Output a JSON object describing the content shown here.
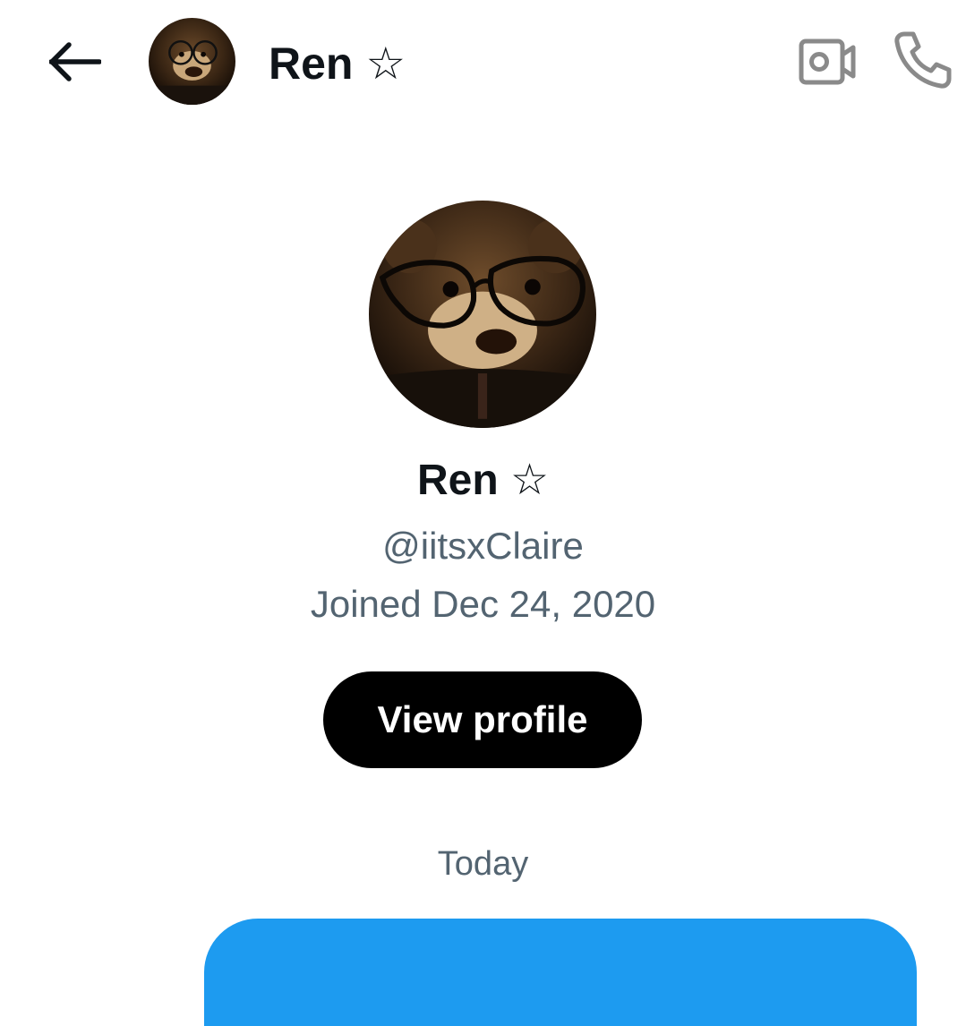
{
  "header": {
    "back_icon": "arrow-left-icon",
    "contact_name": "Ren ☆",
    "video_icon": "video-call-icon",
    "phone_icon": "phone-icon"
  },
  "profile": {
    "avatar_description_icon": "avatar",
    "name": "Ren ☆",
    "handle": "@iitsxClaire",
    "joined": "Joined Dec 24, 2020",
    "view_profile_label": "View profile"
  },
  "conversation": {
    "date_divider": "Today"
  },
  "colors": {
    "text_primary": "#0f1419",
    "text_secondary": "#536471",
    "button_bg": "#000000",
    "button_text": "#ffffff",
    "bubble_bg": "#1d9bf0",
    "icon_gray": "#8a8a8a"
  }
}
